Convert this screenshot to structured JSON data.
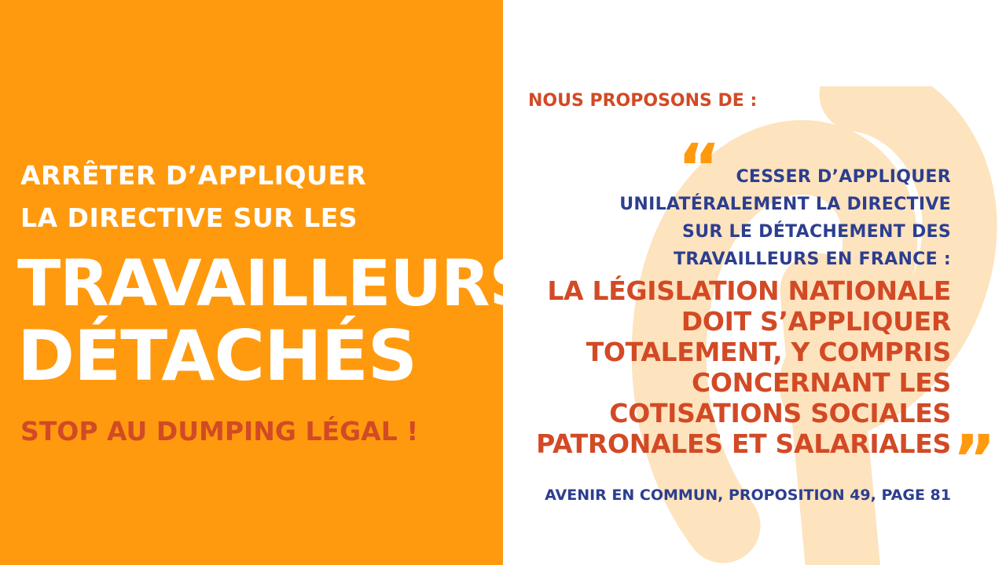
{
  "left": {
    "line1": "ARRÊTER D’APPLIQUER",
    "line2": "LA DIRECTIVE SUR LES",
    "big1": "TRAVAILLEURS",
    "big2": "DÉTACHÉS",
    "slogan": "STOP AU DUMPING LÉGAL !"
  },
  "right": {
    "heading": "NOUS PROPOSONS DE :",
    "quote_open": "“",
    "quote_lines": [
      "CESSER D’APPLIQUER",
      "UNILATÉRALEMENT LA DIRECTIVE",
      "SUR LE DÉTACHEMENT DES",
      "TRAVAILLEURS EN FRANCE :"
    ],
    "highlight_lines": [
      "LA LÉGISLATION NATIONALE",
      "DOIT S’APPLIQUER",
      "TOTALEMENT, Y COMPRIS",
      "CONCERNANT LES",
      "COTISATIONS SOCIALES",
      "PATRONALES ET SALARIALES"
    ],
    "quote_close": "”",
    "source": "AVENIR EN COMMUN, PROPOSITION 49, PAGE 81"
  },
  "colors": {
    "orange": "#FF9A0E",
    "red": "#D24A25",
    "blue": "#2C3E8F",
    "pale_orange": "#FDE3BE"
  },
  "watermark_icon": "phi-logo-icon"
}
